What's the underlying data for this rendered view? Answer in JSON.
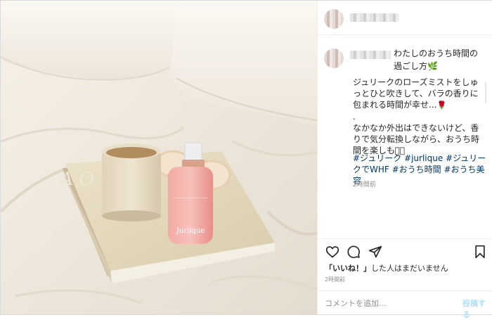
{
  "post": {
    "caption_title": "わたしのおうち時間の過ごし方",
    "title_emoji": "🌿",
    "caption_lines": [
      "ジュリークのローズミストをしゅっとひと吹きして、バラの香りに包まれる時間が幸せ...",
      ".",
      "なかなか外出はできないけど、香りで気分転換しながら、おうち時間を楽しもう🏻"
    ],
    "rose_emoji": "🌹",
    "hashtags": "#ジュリーク #jurlique #ジュリークでWHF #おうち時間 #おうち美容",
    "caption_time": "2時間前",
    "likes_bold": "「いいね！」",
    "likes_rest": "した人はまだいません",
    "post_time": "2時間前"
  },
  "comment": {
    "placeholder": "コメントを追加...",
    "post_button": "投稿する"
  },
  "photo": {
    "book_cover_text": "A  O",
    "bottle_label": "Jurlique"
  },
  "icons": [
    "heart-icon",
    "comment-icon",
    "share-icon",
    "bookmark-icon"
  ],
  "colors": {
    "link": "#00376b",
    "muted": "#8e8e8e",
    "post_button": "#b2dffc",
    "text": "#262626"
  }
}
